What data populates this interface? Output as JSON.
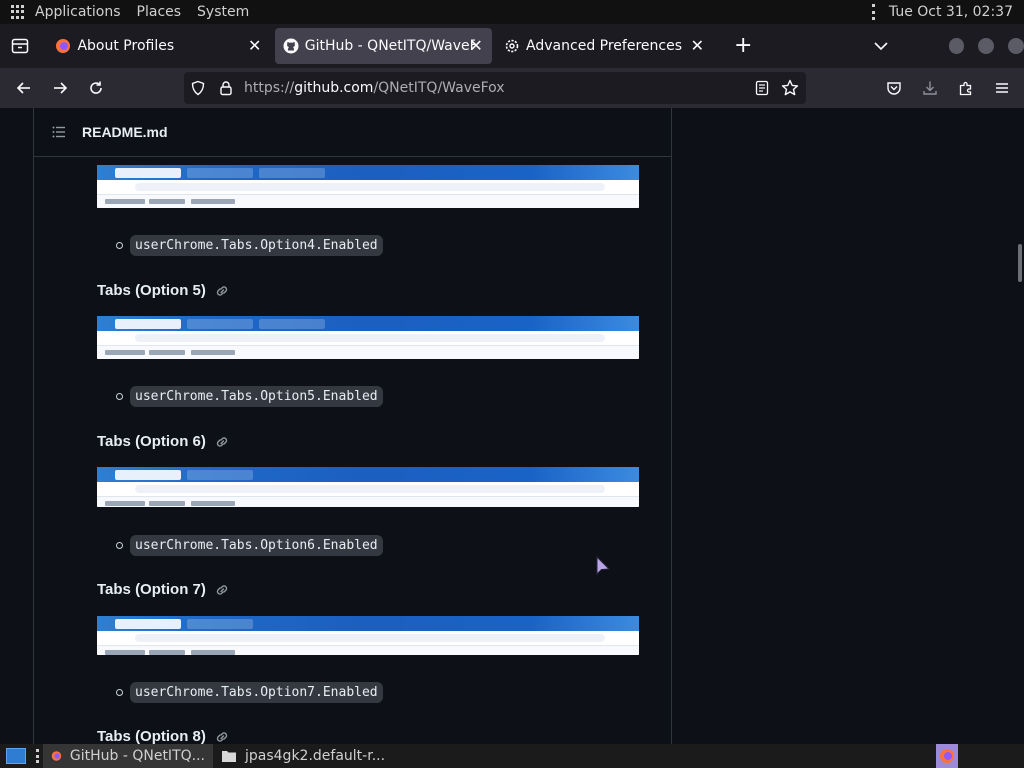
{
  "topbar": {
    "menus": [
      "Applications",
      "Places",
      "System"
    ],
    "clock": "Tue Oct 31, 02:37"
  },
  "tabs": [
    {
      "label": "About Profiles",
      "icon": "firefox-icon",
      "active": false
    },
    {
      "label": "GitHub - QNetITQ/WaveFox",
      "icon": "github-icon",
      "active": true
    },
    {
      "label": "Advanced Preferences",
      "icon": "gear-icon",
      "active": false
    }
  ],
  "navbar": {
    "url_prefix": "https://",
    "url_host": "github.com",
    "url_path": "/QNetITQ/WaveFox"
  },
  "readme": {
    "filename": "README.md",
    "items": [
      {
        "code": "userChrome.Tabs.Option4.Enabled"
      },
      {
        "heading": "Tabs (Option 5)",
        "code": "userChrome.Tabs.Option5.Enabled"
      },
      {
        "heading": "Tabs (Option 6)",
        "code": "userChrome.Tabs.Option6.Enabled"
      },
      {
        "heading": "Tabs (Option 7)",
        "code": "userChrome.Tabs.Option7.Enabled"
      },
      {
        "heading": "Tabs (Option 8)"
      }
    ]
  },
  "taskbar": {
    "tasks": [
      {
        "label": "GitHub - QNetITQ...",
        "icon": "firefox-icon",
        "active": true
      },
      {
        "label": "jpas4gk2.default-r...",
        "icon": "folder-icon",
        "active": false
      }
    ]
  }
}
